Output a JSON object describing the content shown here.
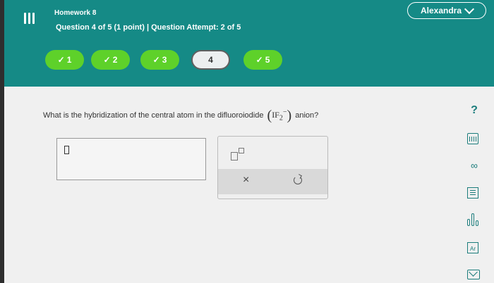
{
  "header": {
    "assignment_title": "Homework 8",
    "question_info": "Question 4 of 5 (1 point)  |  Question Attempt: 2 of 5",
    "user_name": "Alexandra"
  },
  "nav": [
    {
      "check": "✓",
      "label": "1",
      "state": "completed"
    },
    {
      "check": "✓",
      "label": "2",
      "state": "completed"
    },
    {
      "check": "✓",
      "label": "3",
      "state": "completed"
    },
    {
      "check": "",
      "label": "4",
      "state": "current"
    },
    {
      "check": "✓",
      "label": "5",
      "state": "completed"
    }
  ],
  "question": {
    "text_before": "What is the hybridization of the central atom in the difluoroiodide",
    "formula_main": "IF",
    "formula_sub": "2",
    "formula_sup": "−",
    "text_after": "anion?"
  },
  "tools": {
    "clear": "×"
  },
  "sidebar": {
    "help": "?",
    "link": "∞",
    "periodic_label": "Ar"
  },
  "colors": {
    "header": "#158a86",
    "completed": "#5ed12a",
    "icon": "#1a7c7b"
  }
}
